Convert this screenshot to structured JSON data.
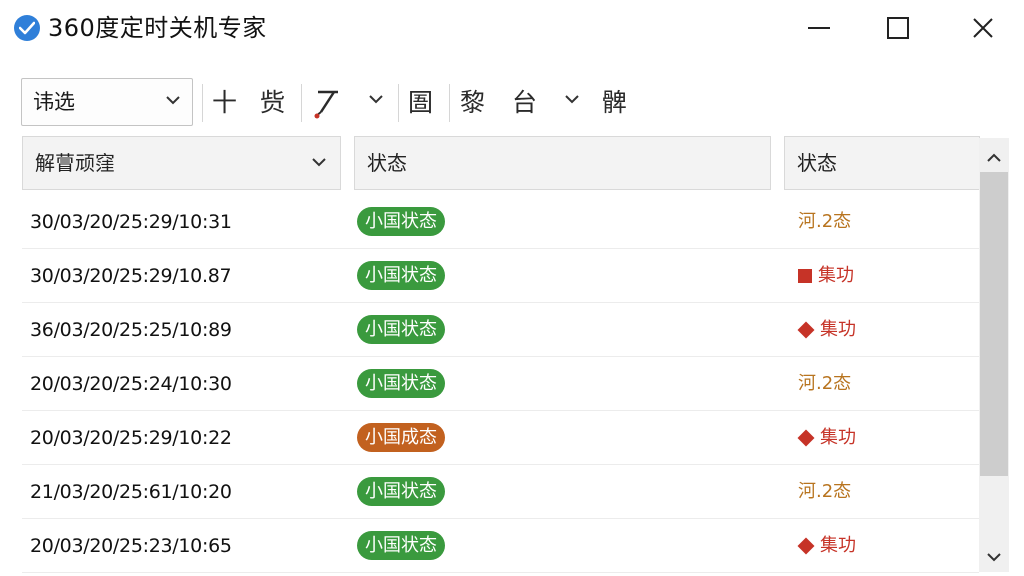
{
  "window": {
    "title": "360度定时关机专家"
  },
  "toolbar": {
    "filter_select_value": "讳选",
    "btn_add": "十",
    "btn_2": "赀",
    "btn_3": "圄",
    "btn_4": "黎",
    "btn_5": "台",
    "btn_6": "髀"
  },
  "table": {
    "columns": [
      "解萺顽窪",
      "状态",
      "状态"
    ],
    "rows": [
      {
        "datetime": "30/03/20/25:29/10:31",
        "status": "小国状态",
        "result": "河.2态",
        "result_kind": "text"
      },
      {
        "datetime": "30/03/20/25:29/10.87",
        "status": "小国状态",
        "result": "集功",
        "result_kind": "square"
      },
      {
        "datetime": "36/03/20/25:25/10:89",
        "status": "小国状态",
        "result": "集功",
        "result_kind": "diamond"
      },
      {
        "datetime": "20/03/20/25:24/10:30",
        "status": "小国状态",
        "result": "河.2态",
        "result_kind": "text"
      },
      {
        "datetime": "20/03/20/25:29/10:22",
        "status": "小国成态",
        "result": "集功",
        "result_kind": "diamond"
      },
      {
        "datetime": "21/03/20/25:61/10:20",
        "status": "小国状态",
        "result": "河.2态",
        "result_kind": "text"
      },
      {
        "datetime": "20/03/20/25:23/10:65",
        "status": "小国状态",
        "result": "集功",
        "result_kind": "diamond"
      }
    ],
    "status_colors": {
      "green": "#3a9a3e",
      "orange": "#c2611f"
    },
    "result_colors": {
      "text": "#b8741f",
      "marker": "#c63327"
    }
  }
}
